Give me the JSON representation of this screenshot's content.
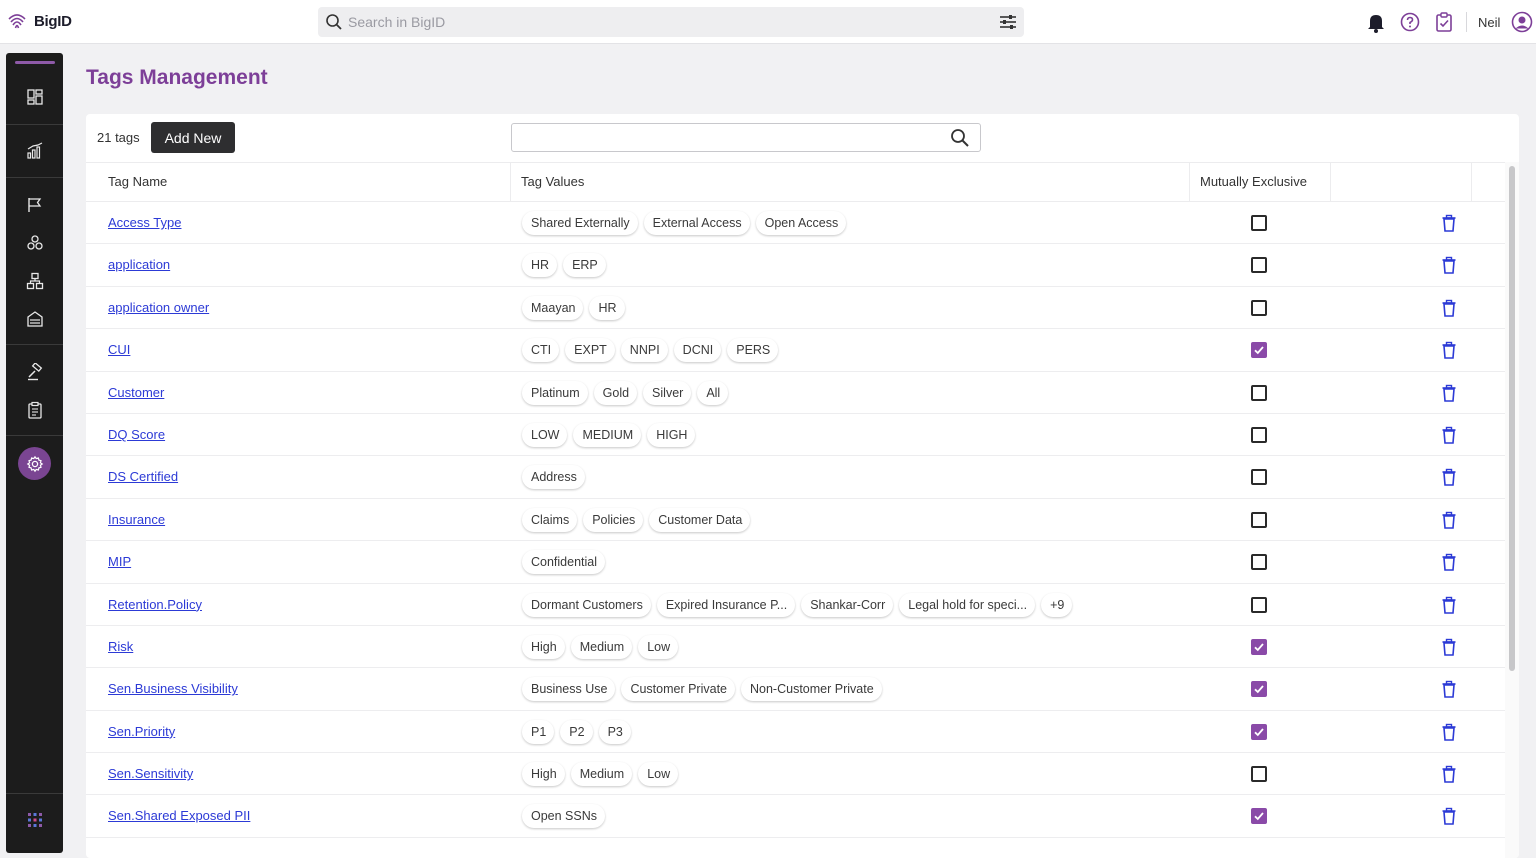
{
  "app": {
    "name": "BigID"
  },
  "search": {
    "placeholder": "Search in BigID"
  },
  "user": {
    "name": "Neil"
  },
  "page": {
    "title": "Tags Management"
  },
  "toolbar": {
    "count_label": "21 tags",
    "add_label": "Add New"
  },
  "columns": {
    "name": "Tag Name",
    "values": "Tag Values",
    "mutually_exclusive": "Mutually Exclusive"
  },
  "colors": {
    "accent": "#7d3f98",
    "link": "#2c3ad6",
    "sidebar": "#1c1c1c"
  },
  "tags": [
    {
      "name": "Access Type",
      "values": [
        "Shared Externally",
        "External Access",
        "Open Access"
      ],
      "exclusive": false
    },
    {
      "name": "application",
      "values": [
        "HR",
        "ERP"
      ],
      "exclusive": false
    },
    {
      "name": "application owner",
      "values": [
        "Maayan",
        "HR"
      ],
      "exclusive": false
    },
    {
      "name": "CUI",
      "values": [
        "CTI",
        "EXPT",
        "NNPI",
        "DCNI",
        "PERS"
      ],
      "exclusive": true
    },
    {
      "name": "Customer",
      "values": [
        "Platinum",
        "Gold",
        "Silver",
        "All"
      ],
      "exclusive": false
    },
    {
      "name": "DQ Score",
      "values": [
        "LOW",
        "MEDIUM",
        "HIGH"
      ],
      "exclusive": false
    },
    {
      "name": "DS Certified",
      "values": [
        "Address"
      ],
      "exclusive": false
    },
    {
      "name": "Insurance",
      "values": [
        "Claims",
        "Policies",
        "Customer Data"
      ],
      "exclusive": false
    },
    {
      "name": "MIP",
      "values": [
        "Confidential"
      ],
      "exclusive": false
    },
    {
      "name": "Retention.Policy",
      "values": [
        "Dormant Customers",
        "Expired Insurance P...",
        "Shankar-Corr",
        "Legal hold for speci...",
        "+9"
      ],
      "exclusive": false
    },
    {
      "name": "Risk",
      "values": [
        "High",
        "Medium",
        "Low"
      ],
      "exclusive": true
    },
    {
      "name": "Sen.Business Visibility",
      "values": [
        "Business Use",
        "Customer Private",
        "Non-Customer Private"
      ],
      "exclusive": true
    },
    {
      "name": "Sen.Priority",
      "values": [
        "P1",
        "P2",
        "P3"
      ],
      "exclusive": true
    },
    {
      "name": "Sen.Sensitivity",
      "values": [
        "High",
        "Medium",
        "Low"
      ],
      "exclusive": false
    },
    {
      "name": "Sen.Shared Exposed PII",
      "values": [
        "Open SSNs"
      ],
      "exclusive": true
    }
  ]
}
